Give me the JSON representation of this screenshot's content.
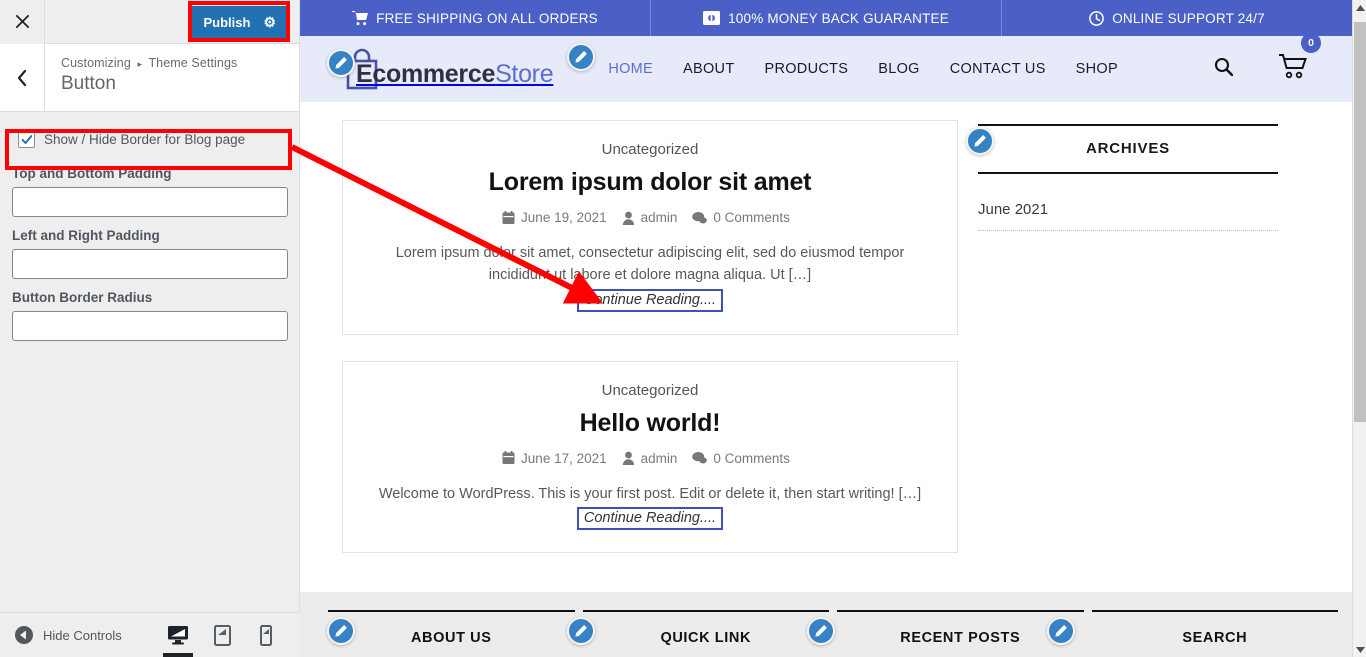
{
  "customizer": {
    "close_icon": "close-icon",
    "publish_label": "Publish",
    "publish_gear_icon": "gear-icon",
    "back_icon": "chevron-left-icon",
    "breadcrumb_root": "Customizing",
    "breadcrumb_sep": "▸",
    "breadcrumb_parent": "Theme Settings",
    "page_title": "Button",
    "checkbox": {
      "label": "Show / Hide Border for Blog page",
      "checked": true
    },
    "fields": [
      {
        "label": "Top and Bottom Padding",
        "value": "",
        "placeholder": ""
      },
      {
        "label": "Left and Right Padding",
        "value": "",
        "placeholder": ""
      },
      {
        "label": "Button Border Radius",
        "value": "",
        "placeholder": ""
      }
    ],
    "footer": {
      "hide_controls_label": "Hide Controls",
      "devices": [
        {
          "name": "desktop",
          "active": true
        },
        {
          "name": "tablet",
          "active": false
        },
        {
          "name": "mobile",
          "active": false
        }
      ]
    },
    "accent_color": "#2271b1"
  },
  "site": {
    "topbar": {
      "background": "#4a60c6",
      "items": [
        {
          "icon": "shopping-cart-icon",
          "text": "FREE SHIPPING ON ALL ORDERS"
        },
        {
          "icon": "money-icon",
          "text": "100% MONEY BACK GUARANTEE"
        },
        {
          "icon": "clock-icon",
          "text": "ONLINE SUPPORT 24/7"
        }
      ]
    },
    "header": {
      "background": "#e7eaf8",
      "logo_icon": "shopping-bag-icon",
      "logo_primary": "Ecommerce",
      "logo_secondary": "Store",
      "nav": [
        {
          "label": "HOME",
          "active": true
        },
        {
          "label": "ABOUT",
          "active": false
        },
        {
          "label": "PRODUCTS",
          "active": false
        },
        {
          "label": "BLOG",
          "active": false
        },
        {
          "label": "CONTACT US",
          "active": false
        },
        {
          "label": "SHOP",
          "active": false
        }
      ],
      "search_icon": "search-icon",
      "cart_icon": "cart-icon",
      "cart_count": "0"
    },
    "posts": [
      {
        "category": "Uncategorized",
        "title": "Lorem ipsum dolor sit amet",
        "date": "June 19, 2021",
        "author": "admin",
        "comments": "0 Comments",
        "excerpt": "Lorem ipsum dolor sit amet, consectetur adipiscing elit, sed do eiusmod tempor incididunt ut labore et dolore magna aliqua. Ut […]",
        "continue_label": "Continue Reading...."
      },
      {
        "category": "Uncategorized",
        "title": "Hello world!",
        "date": "June 17, 2021",
        "author": "admin",
        "comments": "0 Comments",
        "excerpt": "Welcome to WordPress. This is your first post. Edit or delete it, then start writing! […]",
        "continue_label": "Continue Reading...."
      }
    ],
    "sidebar": {
      "widget_title": "ARCHIVES",
      "items": [
        "June 2021"
      ]
    },
    "footer_columns": [
      {
        "title": "ABOUT US"
      },
      {
        "title": "QUICK LINK"
      },
      {
        "title": "RECENT POSTS"
      },
      {
        "title": "SEARCH"
      }
    ]
  },
  "annotations": {
    "highlight_color": "#ff0000",
    "arrow_color": "#ff0000",
    "boxes": [
      {
        "name": "publish-button-highlight"
      },
      {
        "name": "checkbox-row-highlight"
      }
    ],
    "arrow": {
      "name": "pointer-arrow",
      "from": "checkbox-row",
      "to": "continue-reading-link"
    }
  }
}
